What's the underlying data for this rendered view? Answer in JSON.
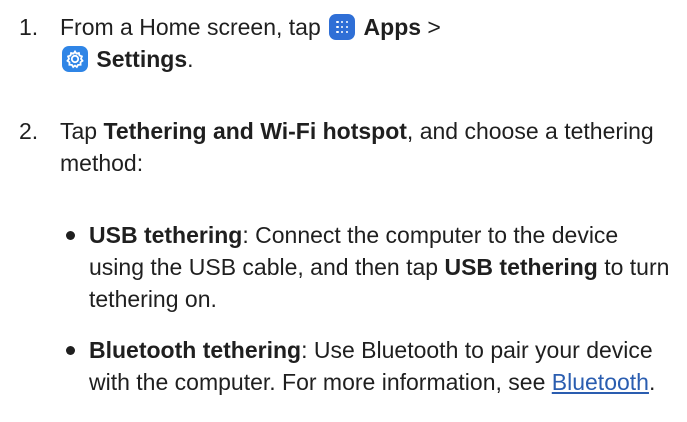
{
  "steps": [
    {
      "number": "1.",
      "text_1": "From a Home screen, tap ",
      "apps_label": "Apps",
      "separator": " >",
      "settings_label": "Settings",
      "end": ".",
      "apps_icon": "apps-grid-icon",
      "settings_icon": "settings-gear-icon"
    },
    {
      "number": "2.",
      "text_1": "Tap ",
      "bold_1": "Tethering and Wi-Fi hotspot",
      "text_2": ", and choose a tethering method:"
    }
  ],
  "bullets": [
    {
      "bold_1": "USB tethering",
      "text_1": ": Connect the computer to the device using the USB cable, and then tap ",
      "bold_2": "USB tethering",
      "text_2": " to turn tethering on."
    },
    {
      "bold_1": "Bluetooth tethering",
      "text_1": ": Use Bluetooth to pair your device with the computer. For more information, see ",
      "link_label": "Bluetooth",
      "text_2": "."
    }
  ],
  "colors": {
    "text": "#1f1f1f",
    "link": "#2a5db0",
    "apps_icon_bg": "#2f6fd6",
    "settings_icon_bg": "#2f85e6"
  }
}
